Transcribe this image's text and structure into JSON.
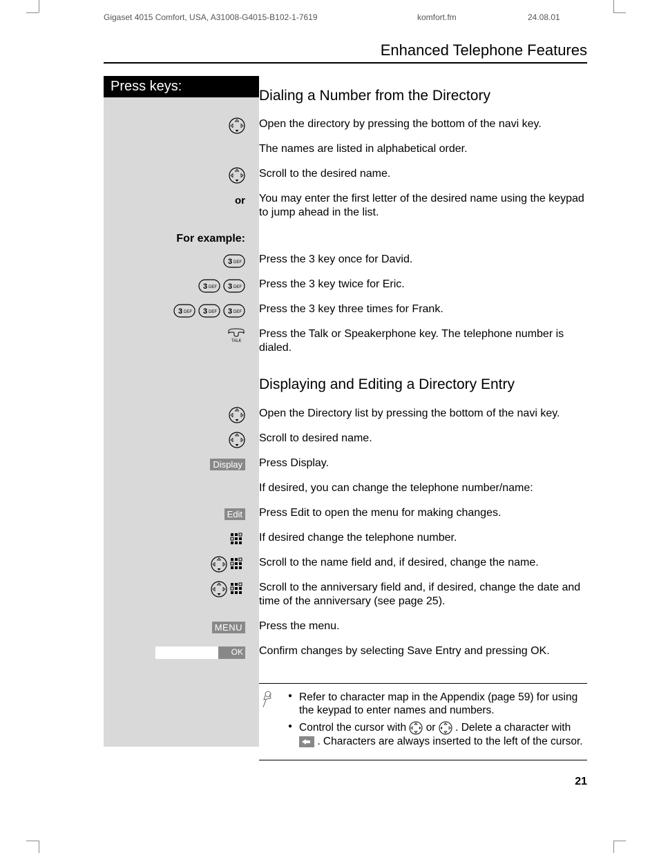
{
  "meta": {
    "doc": "Gigaset 4015 Comfort, USA, A31008-G4015-B102-1-7619",
    "file": "komfort.fm",
    "date": "24.08.01"
  },
  "section_title": "Enhanced Telephone Features",
  "press_keys_label": "Press keys:",
  "h_dial": "Dialing a Number from the Directory",
  "p_open_dir": "Open the directory by pressing the bottom of the navi key.",
  "p_alpha": "The names are listed in alphabetical order.",
  "p_scroll_name": "Scroll to the desired name.",
  "label_or": "or",
  "p_first_letter": "You may enter the first letter of the desired name using the keypad to jump ahead in the list.",
  "label_example": "For example:",
  "p_david": "Press the 3 key once for David.",
  "p_eric": "Press the 3 key twice for Eric.",
  "p_frank": "Press the 3 key three times for Frank.",
  "p_talk": "Press the Talk or Speakerphone key. The telephone number is dialed.",
  "h_display": "Displaying and Editing a Directory Entry",
  "p_open_list": "Open the Directory list by pressing the bottom of the navi key.",
  "p_scroll_desired": "Scroll to desired name.",
  "soft_display": "Display",
  "p_press_display": "Press Display.",
  "p_if_change": "If desired, you can change the telephone number/name:",
  "soft_edit": "Edit",
  "p_press_edit": "Press Edit to open the menu for making changes.",
  "p_change_num": "If desired change the telephone number.",
  "p_change_name": "Scroll to the name field and, if desired, change the name.",
  "p_change_anniv": "Scroll to the anniversary field and, if desired, change the date and time of the anniversary (see page 25).",
  "soft_menu": "MENU",
  "p_press_menu": "Press the menu.",
  "soft_ok": "OK",
  "p_confirm": "Confirm changes by selecting Save Entry and pressing OK.",
  "note1": "Refer to character map in the Appendix (page 59) for using the keypad to enter names and numbers.",
  "note2_a": "Control the cursor with ",
  "note2_b": " or ",
  "note2_c": ". Delete a character with ",
  "note2_d": ". Characters are always inserted to the left of the cursor.",
  "page_num": "21"
}
